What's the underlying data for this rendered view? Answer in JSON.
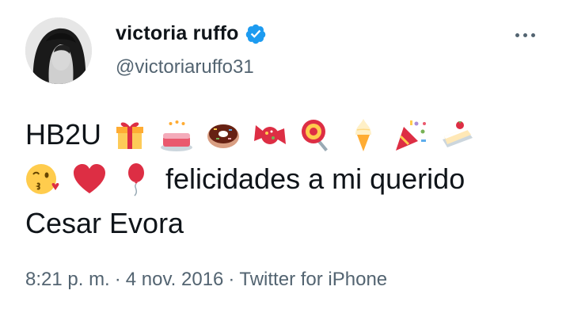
{
  "tweet": {
    "display_name": "victoria ruffo",
    "handle": "@victoriaruffo31",
    "verified": true,
    "text_line1_word": "HB2U",
    "text_line2_words": "felicidades a mi querido",
    "text_line3": "Cesar Evora",
    "emojis_line1": [
      "gift",
      "birthday-cake",
      "doughnut",
      "wrapped-candy",
      "lollipop",
      "soft-ice-cream",
      "party-popper",
      "shortcake"
    ],
    "emojis_line2": [
      "face-blowing-kiss",
      "red-heart",
      "balloon"
    ],
    "time": "8:21 p. m.",
    "date": "4 nov. 2016",
    "source": "Twitter for iPhone",
    "separator": "·"
  },
  "colors": {
    "text": "#0f1419",
    "secondary": "#536471",
    "verified_badge": "#1d9bf0"
  }
}
